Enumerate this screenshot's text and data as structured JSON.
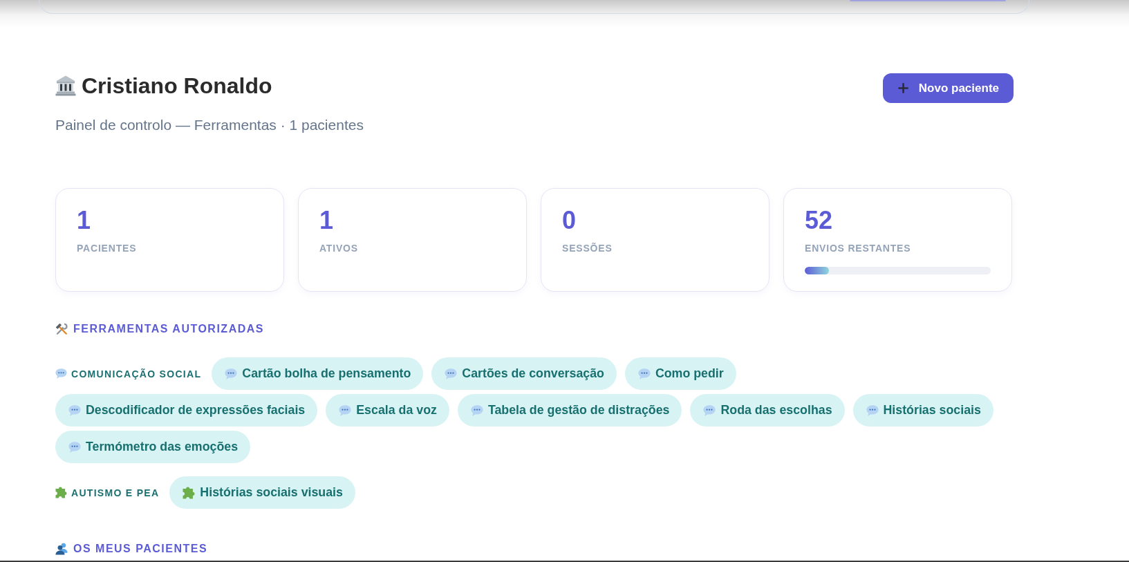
{
  "title": "Cristiano Ronaldo",
  "subtitle": "Painel de controlo — Ferramentas · 1 pacientes",
  "new_patient_button": "Novo paciente",
  "stats": [
    {
      "kind": "count",
      "value": "1",
      "label": "PACIENTES"
    },
    {
      "kind": "count",
      "value": "1",
      "label": "ATIVOS"
    },
    {
      "kind": "count",
      "value": "0",
      "label": "SESSÕES"
    },
    {
      "kind": "meter",
      "value": "52",
      "label": "ENVIOS RESTANTES",
      "level": 0.13
    }
  ],
  "tools_section": {
    "heading": "FERRAMENTAS AUTORIZADAS",
    "categories": [
      {
        "kind": "social",
        "name": "COMUNICAÇÃO SOCIAL",
        "tools": [
          "Cartão bolha de pensamento",
          "Cartões de conversação",
          "Como pedir",
          "Descodificador de expressões faciais",
          "Escala da voz",
          "Tabela de gestão de distrações",
          "Roda das escolhas",
          "Histórias sociais",
          "Termómetro das emoções"
        ]
      },
      {
        "kind": "autism",
        "name": "AUTISMO E PEA",
        "tools": [
          "Histórias sociais visuais"
        ]
      }
    ]
  },
  "patients_section": {
    "heading": "OS MEUS PACIENTES"
  }
}
